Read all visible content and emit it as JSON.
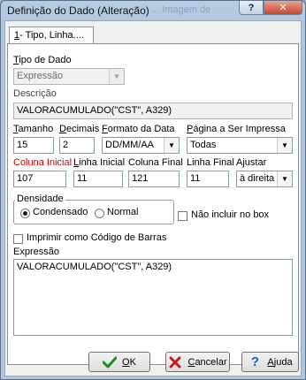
{
  "window": {
    "title": "Definição do Dado (Alteração)",
    "ghost_title": "... Imagem de",
    "help_label": "?",
    "close_label": "✕"
  },
  "tab": {
    "accel": "1",
    "label": "- Tipo, Linha...."
  },
  "tipo_dado": {
    "label_accel": "T",
    "label_rest": "ipo de Dado",
    "value": "Expressão"
  },
  "descricao": {
    "label": "Descrição",
    "value": "VALORACUMULADO(\"CST\", A329)"
  },
  "tamanho": {
    "label_accel": "T",
    "label_rest": "amanho",
    "value": "15"
  },
  "decimais": {
    "label_accel": "D",
    "label_rest": "ecimais",
    "value": "2"
  },
  "formato_data": {
    "label_accel": "F",
    "label_rest": "ormato da Data",
    "value": "DD/MM/AA"
  },
  "pagina": {
    "label_pre": "",
    "label_accel": "P",
    "label_rest": "ágina a Ser Impressa",
    "value": "Todas"
  },
  "coluna_inicial": {
    "label": "Coluna Inicial",
    "value": "107"
  },
  "linha_inicial": {
    "label_accel": "L",
    "label_rest": "inha Inicial",
    "value": "11"
  },
  "coluna_final": {
    "label": "Coluna Final",
    "value": "121"
  },
  "linha_final": {
    "label": "Linha Final",
    "value": "11"
  },
  "ajustar": {
    "label": "Ajustar",
    "value": "à direita"
  },
  "densidade": {
    "legend": "Densidade",
    "opt_condensado": "Condensado",
    "opt_normal": "Normal",
    "selected": "Condensado"
  },
  "nao_incluir_box": {
    "label": "Não incluir no box",
    "checked": false
  },
  "codigo_barras": {
    "label": "Imprimir como Código de Barras",
    "checked": false
  },
  "expressao": {
    "label": "Expressão",
    "value": "VALORACUMULADO(\"CST\", A329)"
  },
  "buttons": {
    "ok_accel": "O",
    "ok_rest": "K",
    "cancel_accel": "C",
    "cancel_rest": "ancelar",
    "help_accel": "A",
    "help_rest": "juda"
  },
  "colors": {
    "ok_check": "#1e8e1e",
    "cancel_x": "#c61a1a",
    "help_q": "#1d5fbf",
    "required_label": "#d40000"
  }
}
